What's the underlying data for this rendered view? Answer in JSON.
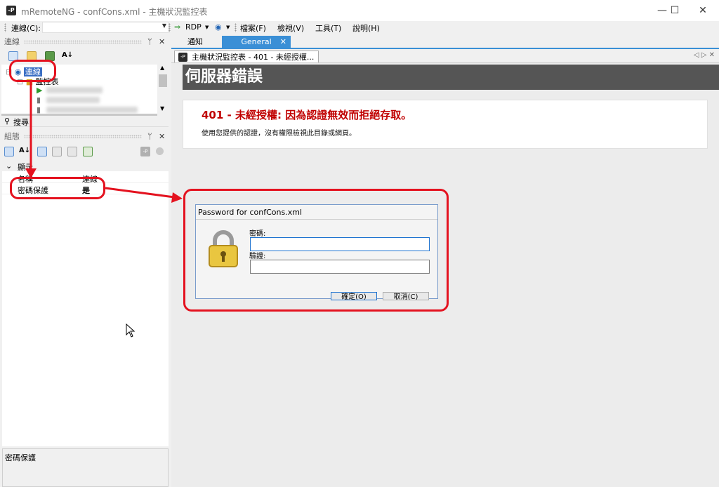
{
  "window": {
    "title": "mRemoteNG - confCons.xml - 主機狀況監控表",
    "controls": [
      "—",
      "☐",
      "✕"
    ]
  },
  "toolbar": {
    "connection_label": "連線(C):",
    "connection_value": "",
    "rdp_label": "RDP",
    "menu": [
      "檔案(F)",
      "檢視(V)",
      "工具(T)",
      "說明(H)"
    ]
  },
  "tabs": [
    {
      "label": "通知",
      "active": false
    },
    {
      "label": "General",
      "active": true
    }
  ],
  "connections_panel": {
    "caption": "連線",
    "pin": "ᛘ",
    "close": "✕",
    "tree": [
      {
        "label": "連線",
        "selected": true
      },
      {
        "label": "監控表",
        "selected": false
      }
    ],
    "search_label": "搜尋"
  },
  "config_panel": {
    "caption": "組態",
    "category": "顯示",
    "properties": [
      {
        "name": "名稱",
        "value": "連線"
      },
      {
        "name": "密碼保護",
        "value": "是"
      }
    ],
    "description": "密碼保護"
  },
  "document": {
    "tab_title": "主機狀況監控表 - 401 - 未經授權...",
    "nav_arrows": "◁ ▷ ✕",
    "header": "伺服器錯誤",
    "error_title": "401 - 未經授權: 因為認證無效而拒絕存取。",
    "error_message": "使用您提供的認證，沒有權限檢視此目錄或網頁。"
  },
  "password_dialog": {
    "title": "Password for confCons.xml",
    "password_label": "密碼:",
    "verify_label": "驗證:",
    "password_value": "",
    "verify_value": "",
    "ok_label": "確定(O)",
    "cancel_label": "取消(C)"
  },
  "colors": {
    "accent": "#3a8fd6",
    "error_red": "#c00000",
    "annotation_red": "#e4121f",
    "header_gray": "#555555"
  }
}
